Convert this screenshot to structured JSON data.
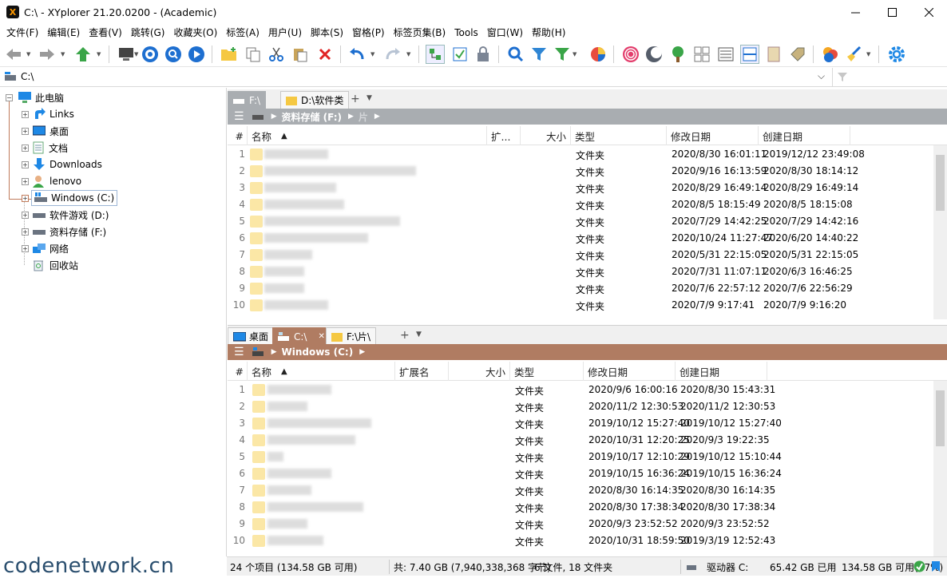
{
  "window": {
    "title": "C:\\ - XYplorer 21.20.0200 - (Academic)",
    "logo_text": "X"
  },
  "menu": [
    "文件(F)",
    "编辑(E)",
    "查看(V)",
    "跳转(G)",
    "收藏夹(O)",
    "标签(A)",
    "用户(U)",
    "脚本(S)",
    "窗格(P)",
    "标签页集(B)",
    "Tools",
    "窗口(W)",
    "帮助(H)"
  ],
  "address": {
    "value": "C:\\"
  },
  "tree": {
    "root": "此电脑",
    "items": [
      "Links",
      "桌面",
      "文档",
      "Downloads",
      "lenovo",
      "Windows (C:)",
      "软件游戏 (D:)",
      "资料存储 (F:)",
      "网络",
      "回收站"
    ]
  },
  "pane1": {
    "tabs": [
      "F:\\",
      "D:\\软件类"
    ],
    "breadcrumb": [
      "资料存储 (F:)",
      "片"
    ],
    "columns": {
      "num": "#",
      "name": "名称",
      "ext": "扩...",
      "size": "大小",
      "type": "类型",
      "modified": "修改日期",
      "created": "创建日期"
    },
    "rows": [
      {
        "n": "1",
        "type": "文件夹",
        "modified": "2020/8/30 16:01:11",
        "created": "2019/12/12 23:49:08"
      },
      {
        "n": "2",
        "type": "文件夹",
        "modified": "2020/9/16 16:13:59",
        "created": "2020/8/30 18:14:12"
      },
      {
        "n": "3",
        "type": "文件夹",
        "modified": "2020/8/29 16:49:14",
        "created": "2020/8/29 16:49:14"
      },
      {
        "n": "4",
        "type": "文件夹",
        "modified": "2020/8/5 18:15:49",
        "created": "2020/8/5 18:15:08"
      },
      {
        "n": "5",
        "type": "文件夹",
        "modified": "2020/7/29 14:42:25",
        "created": "2020/7/29 14:42:16"
      },
      {
        "n": "6",
        "type": "文件夹",
        "modified": "2020/10/24 11:27:47",
        "created": "2020/6/20 14:40:22"
      },
      {
        "n": "7",
        "type": "文件夹",
        "modified": "2020/5/31 22:15:05",
        "created": "2020/5/31 22:15:05"
      },
      {
        "n": "8",
        "type": "文件夹",
        "modified": "2020/7/31 11:07:11",
        "created": "2020/6/3 16:46:25"
      },
      {
        "n": "9",
        "type": "文件夹",
        "modified": "2020/7/6 22:57:12",
        "created": "2020/7/6 22:56:29"
      },
      {
        "n": "10",
        "type": "文件夹",
        "modified": "2020/7/9 9:17:41",
        "created": "2020/7/9 9:16:20"
      }
    ]
  },
  "pane2": {
    "tabs": [
      "桌面",
      "C:\\",
      "F:\\片\\"
    ],
    "breadcrumb": [
      "Windows (C:)"
    ],
    "columns": {
      "num": "#",
      "name": "名称",
      "ext": "扩展名",
      "size": "大小",
      "type": "类型",
      "modified": "修改日期",
      "created": "创建日期"
    },
    "rows": [
      {
        "n": "1",
        "type": "文件夹",
        "modified": "2020/9/6 16:00:16",
        "created": "2020/8/30 15:43:31"
      },
      {
        "n": "2",
        "type": "文件夹",
        "modified": "2020/11/2 12:30:53",
        "created": "2020/11/2 12:30:53"
      },
      {
        "n": "3",
        "type": "文件夹",
        "modified": "2019/10/12 15:27:40",
        "created": "2019/10/12 15:27:40"
      },
      {
        "n": "4",
        "type": "文件夹",
        "modified": "2020/10/31 12:20:25",
        "created": "2020/9/3 19:22:35"
      },
      {
        "n": "5",
        "type": "文件夹",
        "modified": "2019/10/17 12:10:29",
        "created": "2019/10/12 15:10:44"
      },
      {
        "n": "6",
        "type": "文件夹",
        "modified": "2019/10/15 16:36:24",
        "created": "2019/10/15 16:36:24"
      },
      {
        "n": "7",
        "type": "文件夹",
        "modified": "2020/8/30 16:14:35",
        "created": "2020/8/30 16:14:35"
      },
      {
        "n": "8",
        "type": "文件夹",
        "modified": "2020/8/30 17:38:34",
        "created": "2020/8/30 17:38:34"
      },
      {
        "n": "9",
        "type": "文件夹",
        "modified": "2020/9/3 23:52:52",
        "created": "2020/9/3 23:52:52"
      },
      {
        "n": "10",
        "type": "文件夹",
        "modified": "2020/10/31 18:59:50",
        "created": "2019/3/19 12:52:43"
      }
    ]
  },
  "status": {
    "items": "24 个项目 (134.58 GB 可用)",
    "total": "共: 7.40 GB (7,940,338,368 字节)",
    "counts": "6 文件, 18 文件夹",
    "drive": "驱动器 C:",
    "used": "65.42 GB 已用",
    "free": "134.58 GB 可用(67%)"
  },
  "watermark": "codenetwork.cn",
  "colors": {
    "pane1_breadcrumb": "#a9adb1",
    "pane2_breadcrumb": "#b07c62",
    "accent": "#1e88e5"
  }
}
